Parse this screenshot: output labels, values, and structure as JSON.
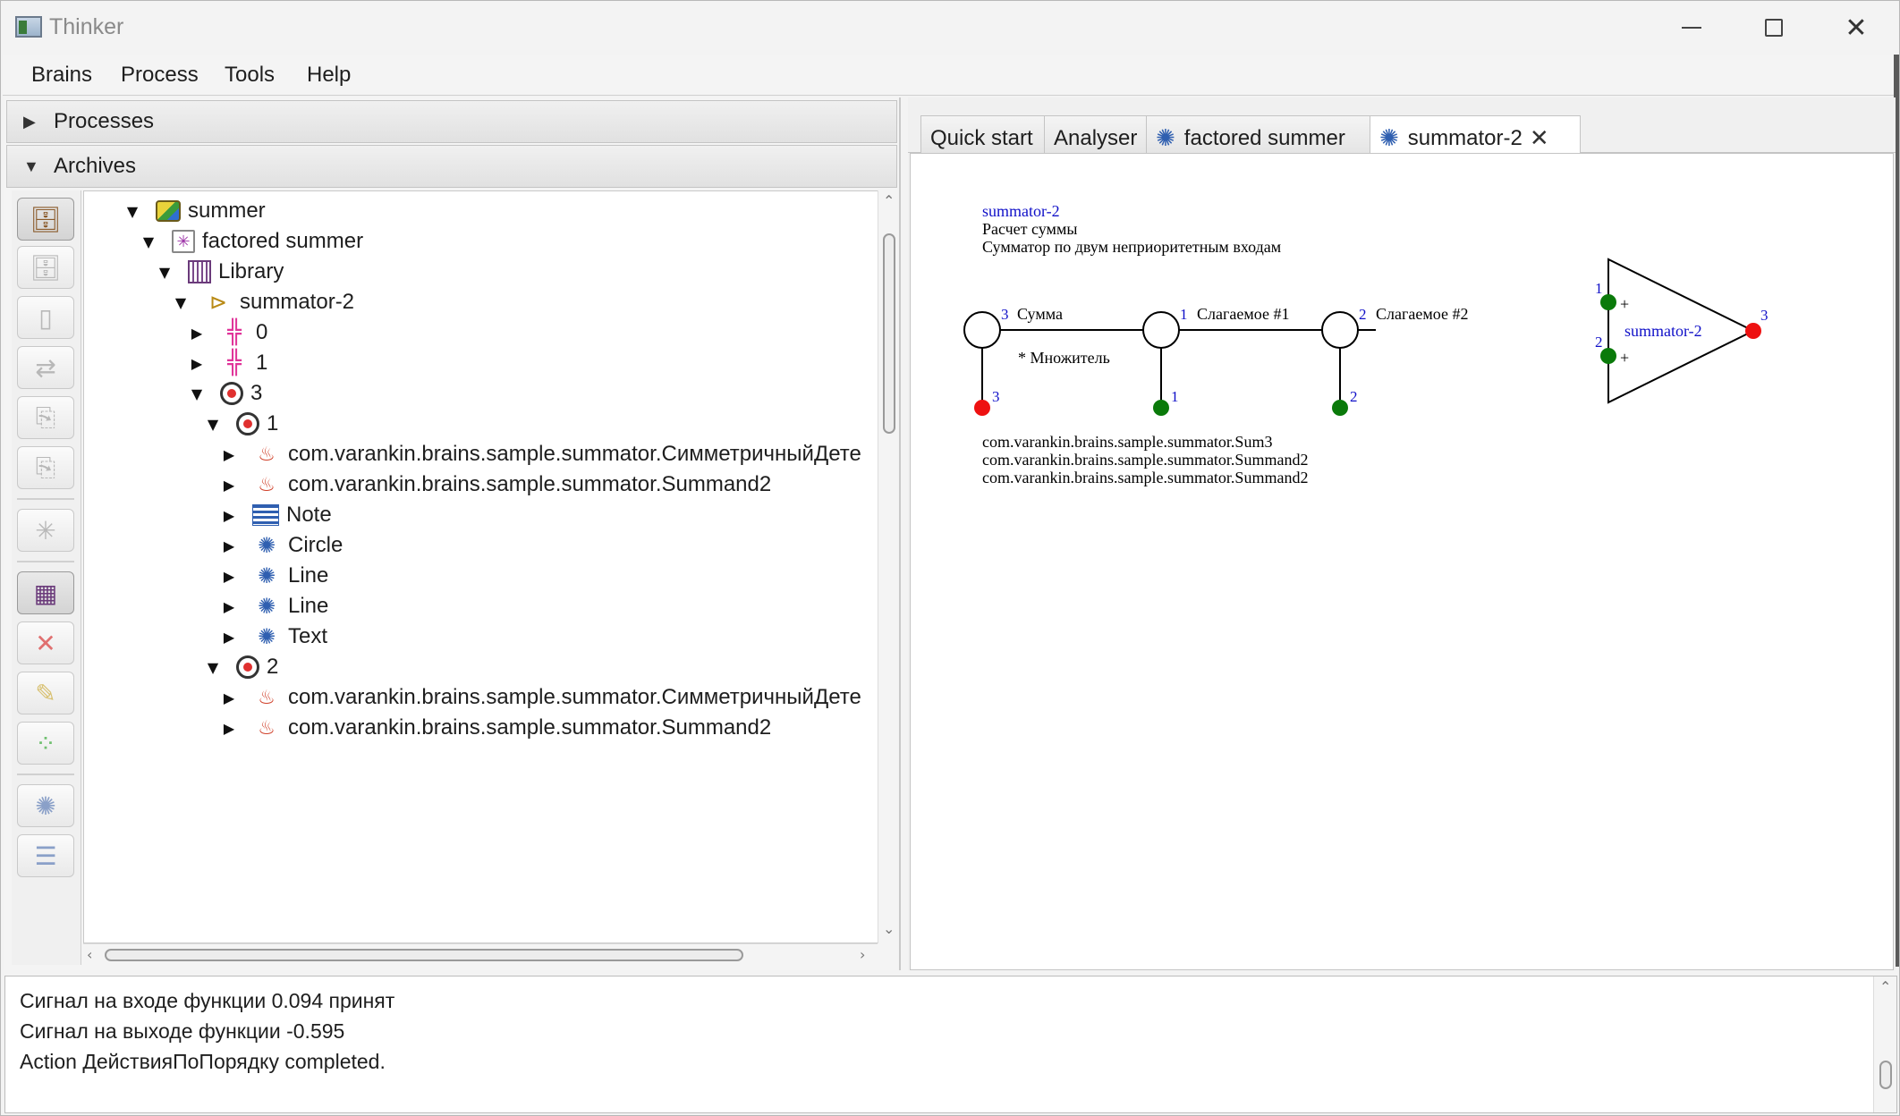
{
  "window": {
    "title": "Thinker"
  },
  "menu": [
    "Brains",
    "Process",
    "Tools",
    "Help"
  ],
  "left": {
    "processes_label": "Processes",
    "archives_label": "Archives"
  },
  "tree": [
    {
      "label": "summer",
      "icon": "package-icon",
      "disc": "expanded"
    },
    {
      "label": "factored summer",
      "icon": "factory-star-icon",
      "disc": "expanded"
    },
    {
      "label": "Library",
      "icon": "library-grid-icon",
      "disc": "expanded"
    },
    {
      "label": "summator-2",
      "icon": "summator-icon",
      "disc": "expanded"
    },
    {
      "label": "0",
      "icon": "connector-icon",
      "disc": "collapsed"
    },
    {
      "label": "1",
      "icon": "connector-icon",
      "disc": "collapsed"
    },
    {
      "label": "3",
      "icon": "target-icon",
      "disc": "expanded"
    },
    {
      "label": "1",
      "icon": "target-icon",
      "disc": "expanded"
    },
    {
      "label": "com.varankin.brains.sample.summator.СимметричныйДете",
      "icon": "java-icon",
      "disc": "collapsed"
    },
    {
      "label": "com.varankin.brains.sample.summator.Summand2",
      "icon": "java-icon",
      "disc": "collapsed"
    },
    {
      "label": "Note",
      "icon": "note-icon",
      "disc": "collapsed"
    },
    {
      "label": "Circle",
      "icon": "eye-icon",
      "disc": "collapsed"
    },
    {
      "label": "Line",
      "icon": "eye-icon",
      "disc": "collapsed"
    },
    {
      "label": "Line",
      "icon": "eye-icon",
      "disc": "collapsed"
    },
    {
      "label": "Text",
      "icon": "eye-icon",
      "disc": "collapsed"
    },
    {
      "label": "2",
      "icon": "target-icon",
      "disc": "expanded"
    },
    {
      "label": "com.varankin.brains.sample.summator.СимметричныйДете",
      "icon": "java-icon",
      "disc": "collapsed"
    },
    {
      "label": "com.varankin.brains.sample.summator.Summand2",
      "icon": "java-icon",
      "disc": "collapsed"
    }
  ],
  "toolbar_icons": [
    "archive-open-icon",
    "archive-icon",
    "document-icon",
    "exchange-icon",
    "import-icon",
    "export-icon",
    "factory-arrow-icon",
    "library-icon",
    "delete-icon",
    "edit-icon",
    "group-icon",
    "view-icon",
    "note-list-icon"
  ],
  "tabs": [
    {
      "label": "Quick start",
      "icon": ""
    },
    {
      "label": "Analyser",
      "icon": ""
    },
    {
      "label": "factored summer",
      "icon": "eye-icon"
    },
    {
      "label": "summator-2",
      "icon": "eye-icon",
      "closable": true,
      "selected": true
    }
  ],
  "canvas": {
    "header": {
      "name": "summator-2",
      "title": "Расчет суммы",
      "description": "Сумматор по двум неприоритетным входам"
    },
    "nodes": [
      {
        "number": "3",
        "label": "Сумма",
        "pin_number": "3",
        "pin_color": "#ee1111"
      },
      {
        "number": "1",
        "label": "Слагаемое #1",
        "pin_number": "1",
        "pin_color": "#0a7a0a"
      },
      {
        "number": "2",
        "label": "Слагаемое #2",
        "pin_number": "2",
        "pin_color": "#0a7a0a"
      }
    ],
    "multiplier_label": "* Множитель",
    "classes": [
      "com.varankin.brains.sample.summator.Sum3",
      "com.varankin.brains.sample.summator.Summand2",
      "com.varankin.brains.sample.summator.Summand2"
    ],
    "triangle": {
      "name": "summator-2",
      "in1": "1",
      "in2": "2",
      "out": "3",
      "plus": "+"
    }
  },
  "console": [
    "Сигнал на входе функции 0.094 принят",
    "Сигнал на выходе функции -0.595",
    "Action ДействияПоПорядку completed."
  ]
}
